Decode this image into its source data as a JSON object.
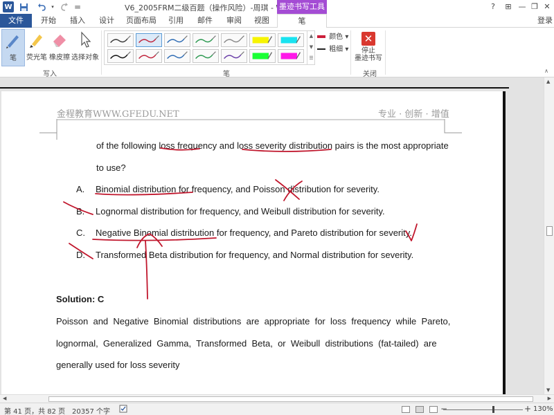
{
  "titlebar": {
    "app_icon": "W",
    "save_icon": "save-icon",
    "undo_icon": "undo-icon",
    "redo_icon": "redo-icon",
    "more_icon": "=",
    "title": "V6_2005FRM二级百题（操作风险）-周琪 - Word",
    "context_tab_title": "墨迹书写工具",
    "help": "?",
    "ribbon_options": "⊞",
    "minimize": "—",
    "restore": "❐",
    "close": "✕"
  },
  "tabs": [
    {
      "label": "文件"
    },
    {
      "label": "开始"
    },
    {
      "label": "插入"
    },
    {
      "label": "设计"
    },
    {
      "label": "页面布局"
    },
    {
      "label": "引用"
    },
    {
      "label": "邮件"
    },
    {
      "label": "审阅"
    },
    {
      "label": "视图"
    },
    {
      "label": "笔"
    }
  ],
  "signin": "登录",
  "ribbon": {
    "write_group": {
      "label": "写入",
      "pen": "笔",
      "highlighter": "荧光笔",
      "eraser": "橡皮擦",
      "select_objects": "选择对象"
    },
    "pens_group": {
      "label": "笔",
      "color": "颜色",
      "thickness": "粗细",
      "color_swatch": "#cc1e3a",
      "thickness_swatch": "#222222",
      "pens": [
        {
          "color": "#3a3a3a",
          "type": "pen"
        },
        {
          "color": "#c0243c",
          "type": "pen",
          "selected": true
        },
        {
          "color": "#2f6cb4",
          "type": "pen"
        },
        {
          "color": "#2e9a52",
          "type": "pen"
        },
        {
          "color": "#8a8a8a",
          "type": "pen"
        },
        {
          "color": "#f7f400",
          "type": "highlighter"
        },
        {
          "color": "#19e3f0",
          "type": "highlighter"
        },
        {
          "color": "#111111",
          "type": "pen"
        },
        {
          "color": "#c0243c",
          "type": "pen"
        },
        {
          "color": "#2f6cb4",
          "type": "pen"
        },
        {
          "color": "#2e9a52",
          "type": "pen"
        },
        {
          "color": "#6a3ea8",
          "type": "pen"
        },
        {
          "color": "#1aff35",
          "type": "highlighter"
        },
        {
          "color": "#ff19e8",
          "type": "highlighter"
        }
      ]
    },
    "close_group": {
      "label": "关闭",
      "stop_inking": "停止\n墨迹书写"
    }
  },
  "document": {
    "header_left": "金程教育WWW.GFEDU.NET",
    "header_right": "专业 · 创新 · 增值",
    "question_line1": "of the following loss frequency and loss severity distribution pairs is the most appropriate",
    "question_line2": "to use?",
    "options": [
      {
        "letter": "A.",
        "text": "Binomial distribution for frequency, and Poisson distribution for severity."
      },
      {
        "letter": "B.",
        "text": "Lognormal distribution for frequency, and Weibull distribution for severity."
      },
      {
        "letter": "C.",
        "text": "Negative Binomial distribution for frequency, and Pareto distribution for severity."
      },
      {
        "letter": "D.",
        "text": "Transformed Beta distribution for frequency, and Normal distribution for severity."
      }
    ],
    "solution_label": "Solution: C",
    "solution_lines": [
      "Poisson  and  Negative  Binomial  distributions  are  appropriate  for  loss  frequency  while  Pareto,",
      "lognormal,  Generalized  Gamma,  Transformed  Beta,  or  Weibull  distributions  (fat-tailed)  are",
      "generally used for loss severity"
    ],
    "ink_color": "#c0162c"
  },
  "statusbar": {
    "page": "第 41 页，共 82 页",
    "words": "20357 个字",
    "zoom_minus": "−",
    "zoom_plus": "+",
    "zoom": "130%",
    "zoom_level": 0.62
  }
}
